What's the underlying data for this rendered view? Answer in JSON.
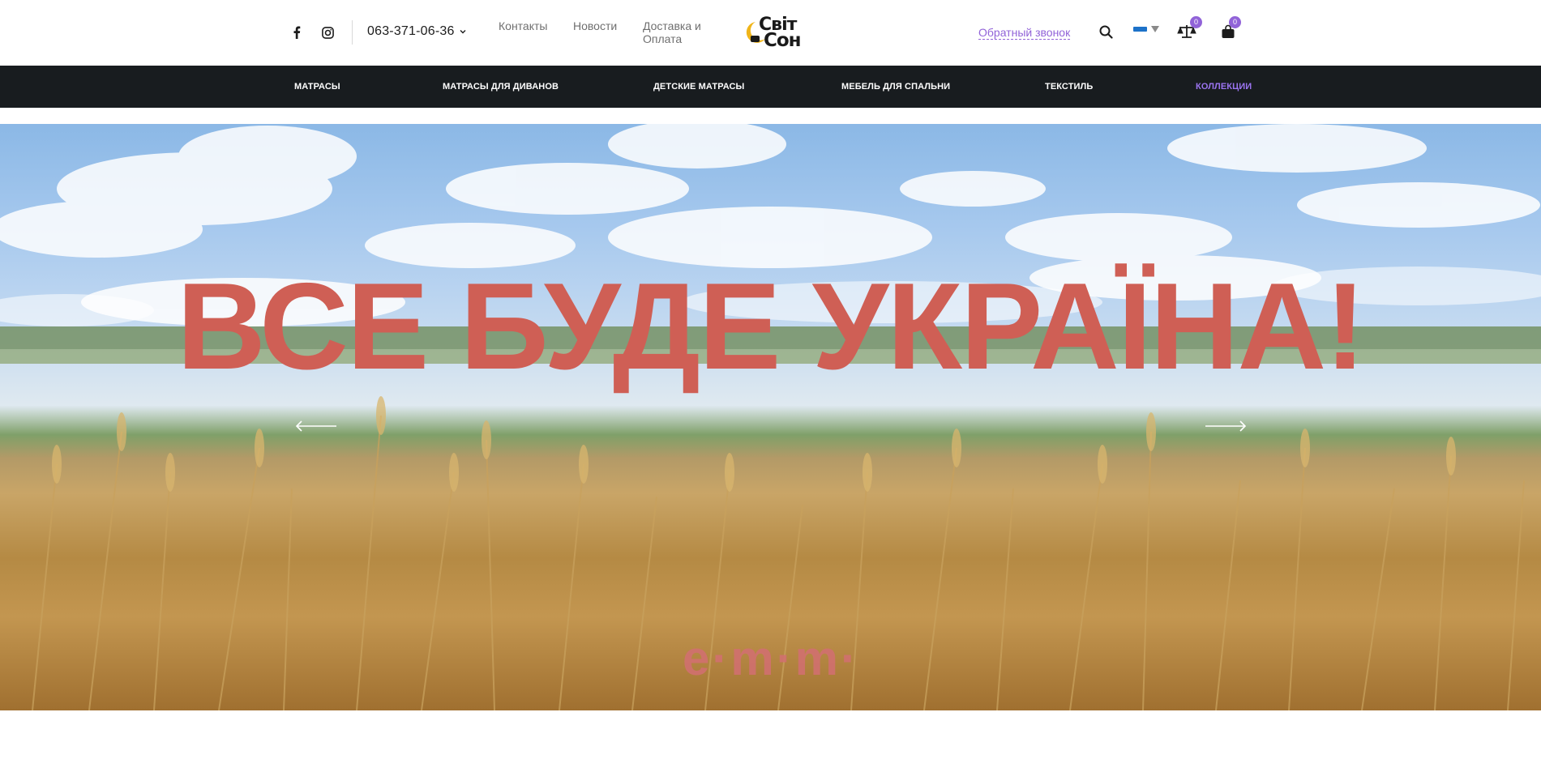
{
  "header": {
    "phone": "063-371-06-36",
    "links": [
      "Контакты",
      "Новости",
      "Доставка и Оплата"
    ],
    "logo": {
      "line1": "Світ",
      "line2": "Сон"
    },
    "callback": "Обратный звонок",
    "compare_count": "0",
    "cart_count": "0"
  },
  "nav": {
    "items": [
      "МАТРАСЫ",
      "МАТРАСЫ ДЛЯ ДИВАНОВ",
      "ДЕТСКИЕ МАТРАСЫ",
      "МЕБЕЛЬ ДЛЯ СПАЛЬНИ",
      "ТЕКСТИЛЬ",
      "КОЛЛЕКЦИИ"
    ],
    "active_index": 5
  },
  "hero": {
    "title": "ВСЕ БУДЕ УКРАЇНА!",
    "brand_mark": "e·m·m·"
  },
  "colors": {
    "accent": "#9163d8",
    "nav_bg": "#181c1f",
    "hero_title": "#cf5f55"
  },
  "icons": [
    "facebook-icon",
    "instagram-icon",
    "chevron-down-icon",
    "search-icon",
    "scales-icon",
    "bag-icon",
    "arrow-left-icon",
    "arrow-right-icon"
  ]
}
